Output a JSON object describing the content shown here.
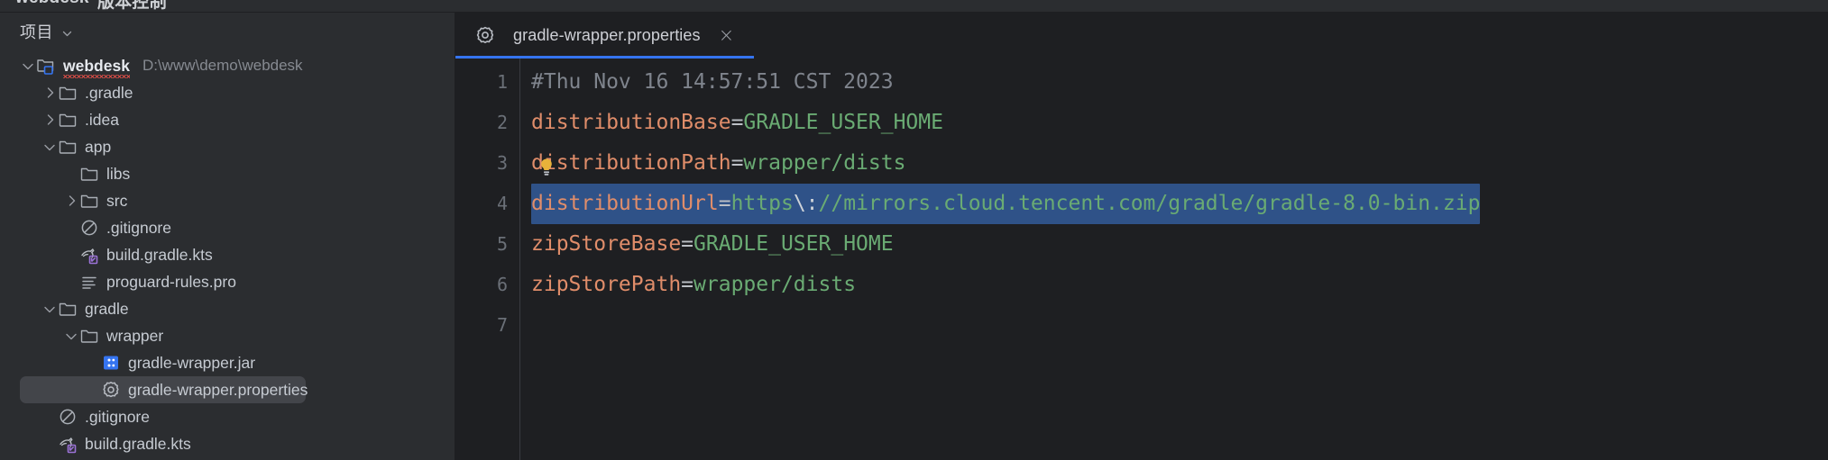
{
  "titlebar": {
    "project_name": "webdesk",
    "menu_text_zh": "版本控制"
  },
  "sidebar": {
    "header": {
      "label": "项目",
      "chevron_icon": "chevron-down-icon"
    },
    "tree": [
      {
        "indent": 0,
        "arrow": "chevron-down-icon",
        "icon": "module-folder-icon",
        "label": "webdesk",
        "path": "D:\\www\\demo\\webdesk",
        "root": true,
        "error": true,
        "selected": false
      },
      {
        "indent": 1,
        "arrow": "chevron-right-icon",
        "icon": "folder-icon",
        "label": ".gradle",
        "path": "",
        "root": false,
        "error": false,
        "selected": false
      },
      {
        "indent": 1,
        "arrow": "chevron-right-icon",
        "icon": "folder-icon",
        "label": ".idea",
        "path": "",
        "root": false,
        "error": false,
        "selected": false
      },
      {
        "indent": 1,
        "arrow": "chevron-down-icon",
        "icon": "folder-icon",
        "label": "app",
        "path": "",
        "root": false,
        "error": false,
        "selected": false
      },
      {
        "indent": 2,
        "arrow": "none",
        "icon": "folder-icon",
        "label": "libs",
        "path": "",
        "root": false,
        "error": false,
        "selected": false
      },
      {
        "indent": 2,
        "arrow": "chevron-right-icon",
        "icon": "folder-icon",
        "label": "src",
        "path": "",
        "root": false,
        "error": false,
        "selected": false
      },
      {
        "indent": 2,
        "arrow": "none",
        "icon": "gitignore-icon",
        "label": ".gitignore",
        "path": "",
        "root": false,
        "error": false,
        "selected": false
      },
      {
        "indent": 2,
        "arrow": "none",
        "icon": "gradle-kts-icon",
        "label": "build.gradle.kts",
        "path": "",
        "root": false,
        "error": false,
        "selected": false
      },
      {
        "indent": 2,
        "arrow": "none",
        "icon": "text-lines-icon",
        "label": "proguard-rules.pro",
        "path": "",
        "root": false,
        "error": false,
        "selected": false
      },
      {
        "indent": 1,
        "arrow": "chevron-down-icon",
        "icon": "folder-icon",
        "label": "gradle",
        "path": "",
        "root": false,
        "error": false,
        "selected": false
      },
      {
        "indent": 2,
        "arrow": "chevron-down-icon",
        "icon": "folder-icon",
        "label": "wrapper",
        "path": "",
        "root": false,
        "error": false,
        "selected": false
      },
      {
        "indent": 3,
        "arrow": "none",
        "icon": "jar-archive-icon",
        "label": "gradle-wrapper.jar",
        "path": "",
        "root": false,
        "error": false,
        "selected": false
      },
      {
        "indent": 3,
        "arrow": "none",
        "icon": "gear-icon",
        "label": "gradle-wrapper.properties",
        "path": "",
        "root": false,
        "error": false,
        "selected": true
      },
      {
        "indent": 1,
        "arrow": "none",
        "icon": "gitignore-icon",
        "label": ".gitignore",
        "path": "",
        "root": false,
        "error": false,
        "selected": false
      },
      {
        "indent": 1,
        "arrow": "none",
        "icon": "gradle-kts-icon",
        "label": "build.gradle.kts",
        "path": "",
        "root": false,
        "error": false,
        "selected": false
      }
    ]
  },
  "editor": {
    "tab": {
      "icon": "gear-icon",
      "title": "gradle-wrapper.properties",
      "close_label": "×",
      "active_underline_color": "#3574f0"
    },
    "gutter": {
      "line_numbers": [
        "1",
        "2",
        "3",
        "4",
        "5",
        "6",
        "7"
      ]
    },
    "intention_bulb": {
      "icon": "lightbulb-icon",
      "line": 3
    },
    "selection_color": "#2f5288",
    "lines": [
      {
        "n": "1",
        "kind": "comment",
        "text": "#Thu Nov 16 14:57:51 CST 2023",
        "selected": false
      },
      {
        "n": "2",
        "kind": "pair",
        "key": "distributionBase",
        "value": "GRADLE_USER_HOME",
        "selected": false
      },
      {
        "n": "3",
        "kind": "pair",
        "key": "distributionPath",
        "value": "wrapper/dists",
        "selected": false
      },
      {
        "n": "4",
        "kind": "pair",
        "key": "distributionUrl",
        "value_pre": "https",
        "value_escape": "\\:",
        "value_post": "//mirrors.cloud.tencent.com/gradle/gradle-8.0-bin.zip",
        "selected": true
      },
      {
        "n": "5",
        "kind": "pair",
        "key": "zipStoreBase",
        "value": "GRADLE_USER_HOME",
        "selected": false
      },
      {
        "n": "6",
        "kind": "pair",
        "key": "zipStorePath",
        "value": "wrapper/dists",
        "selected": false
      },
      {
        "n": "7",
        "kind": "empty",
        "text": "",
        "selected": false
      }
    ]
  },
  "colors": {
    "sidebar_bg": "#2b2d30",
    "editor_bg": "#1e1f22",
    "row_selected_bg": "#43454a",
    "key_color": "#e08d6a",
    "value_color": "#6aab73",
    "comment_color": "#7f848d",
    "accent_blue": "#3574f0"
  }
}
